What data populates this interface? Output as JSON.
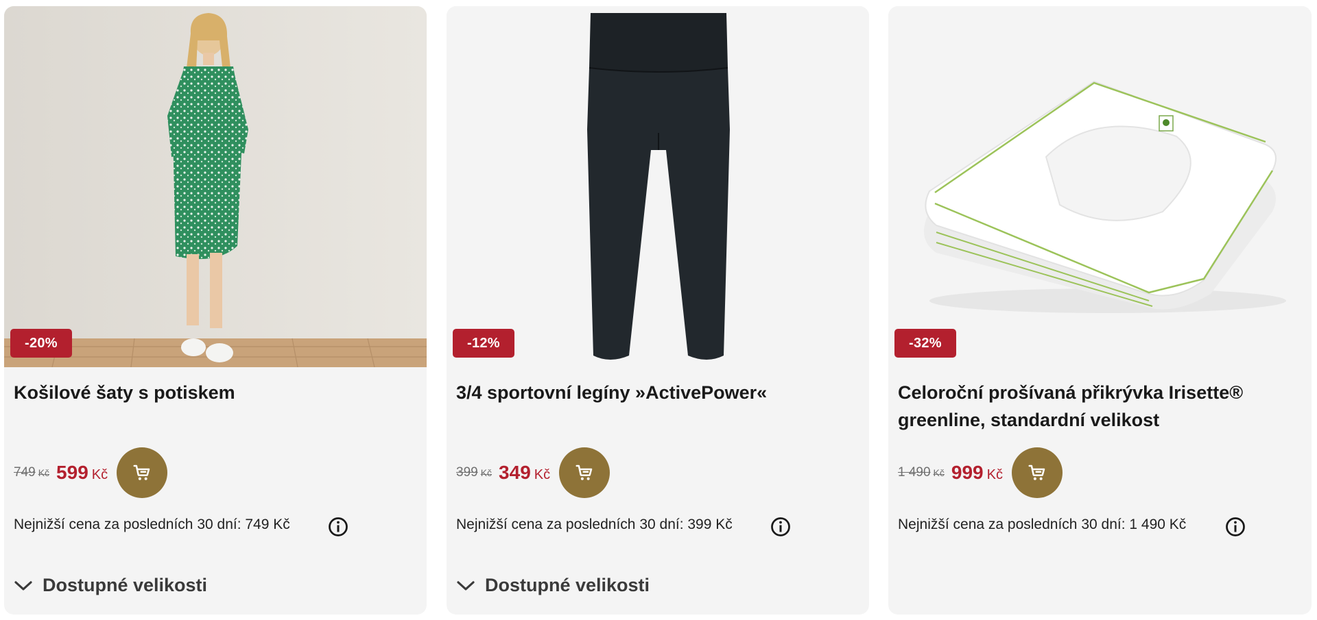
{
  "products": [
    {
      "badge": "-20%",
      "title": "Košilové šaty s potiskem",
      "old_price": "749",
      "currency": "Kč",
      "new_price": "599",
      "lowest_price": "Nejnižší cena za posledních 30 dní: 749 Kč",
      "sizes_label": "Dostupné velikosti"
    },
    {
      "badge": "-12%",
      "title": "3/4 sportovní legíny »ActivePower«",
      "old_price": "399",
      "currency": "Kč",
      "new_price": "349",
      "lowest_price": "Nejnižší cena za posledních 30 dní: 399 Kč",
      "sizes_label": "Dostupné velikosti"
    },
    {
      "badge": "-32%",
      "title": "Celoroční prošívaná přikrývka Irisette® greenline, standardní velikost",
      "old_price": "1 490",
      "currency": "Kč",
      "new_price": "999",
      "lowest_price": "Nejnižší cena za posledních 30 dní: 1 490 Kč"
    }
  ],
  "colors": {
    "sale_red": "#b3202e",
    "cart_gold": "#8e7338",
    "card_bg": "#f4f4f4"
  },
  "icons": {
    "cart": "shopping-cart-icon",
    "info": "info-icon",
    "chevron": "chevron-down-icon"
  }
}
